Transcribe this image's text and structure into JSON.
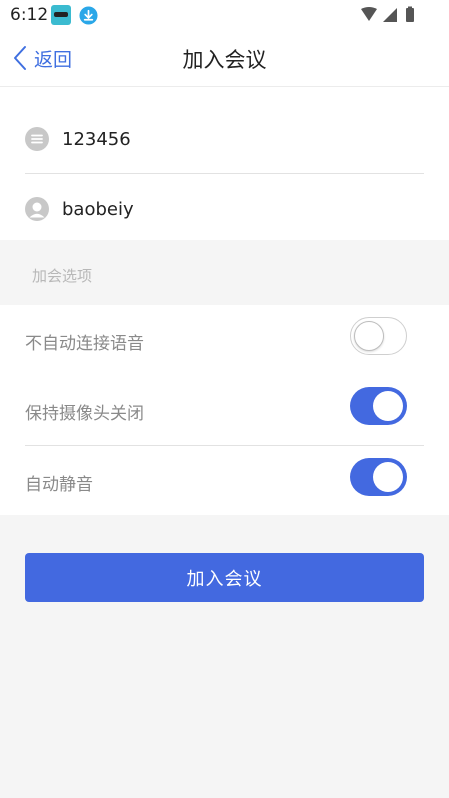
{
  "status_bar": {
    "time": "6:12"
  },
  "nav": {
    "back_label": "返回",
    "title": "加入会议"
  },
  "form": {
    "meeting_id_value": "123456",
    "nickname_value": "baobeiy"
  },
  "options": {
    "section_label": "加会选项",
    "items": [
      {
        "label": "不自动连接语音",
        "enabled": false
      },
      {
        "label": "保持摄像头关闭",
        "enabled": true
      },
      {
        "label": "自动静音",
        "enabled": true
      }
    ]
  },
  "action": {
    "join_label": "加入会议"
  },
  "colors": {
    "accent": "#4369e0",
    "back_link": "#3f6fe0"
  },
  "icons": {
    "meeting_id": "list-icon",
    "nickname": "user-icon",
    "back": "chevron-left-icon"
  }
}
